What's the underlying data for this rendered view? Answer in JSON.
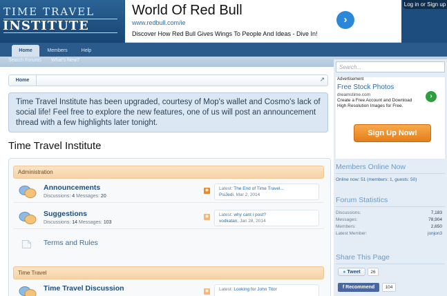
{
  "header": {
    "logo_line1": "TIME TRAVEL",
    "logo_line2": "INSTITUTE",
    "login_label": "Log in or Sign up"
  },
  "ad_banner": {
    "title": "World Of Red Bull",
    "url": "www.redbull.com/ie",
    "description": "Discover How Red Bull Gives Wings To People And Ideas - Dive In!",
    "arrow_icon": "chevron-right-icon"
  },
  "nav": {
    "tabs": [
      "Home",
      "Members",
      "Help"
    ],
    "sub_links": [
      "Search Forums",
      "What's New?"
    ]
  },
  "breadcrumb": {
    "home": "Home"
  },
  "notice": "Time Travel Institute has been upgraded, courtesy of Mop's wallet and Cosmo's lack of social life! Feel free to explore the new features, one of us will post an announcement thread with a few highlights later tonight.",
  "page_title": "Time Travel Institute",
  "categories": [
    {
      "name": "Administration",
      "forums": [
        {
          "name": "Announcements",
          "discussions_label": "Discussions:",
          "discussions": "4",
          "messages_label": "Messages:",
          "messages": "20",
          "last_label": "Latest:",
          "last_title": "The End of Time Travel...",
          "last_user": "PsiJedi",
          "last_date": "Mar 2, 2014"
        },
        {
          "name": "Suggestions",
          "discussions_label": "Discussions:",
          "discussions": "14",
          "messages_label": "Messages:",
          "messages": "103",
          "last_label": "Latest:",
          "last_title": "why cant i post?",
          "last_user": "vodkatan",
          "last_date": "Jan 28, 2014"
        },
        {
          "name": "Terms and Rules"
        }
      ]
    },
    {
      "name": "Time Travel",
      "forums": [
        {
          "name": "Time Travel Discussion",
          "last_label": "Latest:",
          "last_title": "Looking for John Titor"
        }
      ]
    }
  ],
  "sidebar": {
    "search_placeholder": "Search...",
    "ad": {
      "label": "Advertisement",
      "title": "Free Stock Photos",
      "url": "dreamstime.com",
      "description": "Create a Free Account and Download High Resolution Images for Free.",
      "button": "Sign Up Now!"
    },
    "online": {
      "heading": "Members Online Now",
      "text": "Online now: 51 (members: 1, guests: 50)"
    },
    "stats": {
      "heading": "Forum Statistics",
      "rows": [
        {
          "label": "Discussions:",
          "value": "7,183"
        },
        {
          "label": "Messages:",
          "value": "78,904"
        },
        {
          "label": "Members:",
          "value": "2,650"
        },
        {
          "label": "Latest Member:",
          "value": "jonjon3"
        }
      ]
    },
    "share": {
      "heading": "Share This Page",
      "tweet": "Tweet",
      "tweet_count": "26",
      "recommend": "Recommend",
      "recommend_count": "104"
    }
  }
}
